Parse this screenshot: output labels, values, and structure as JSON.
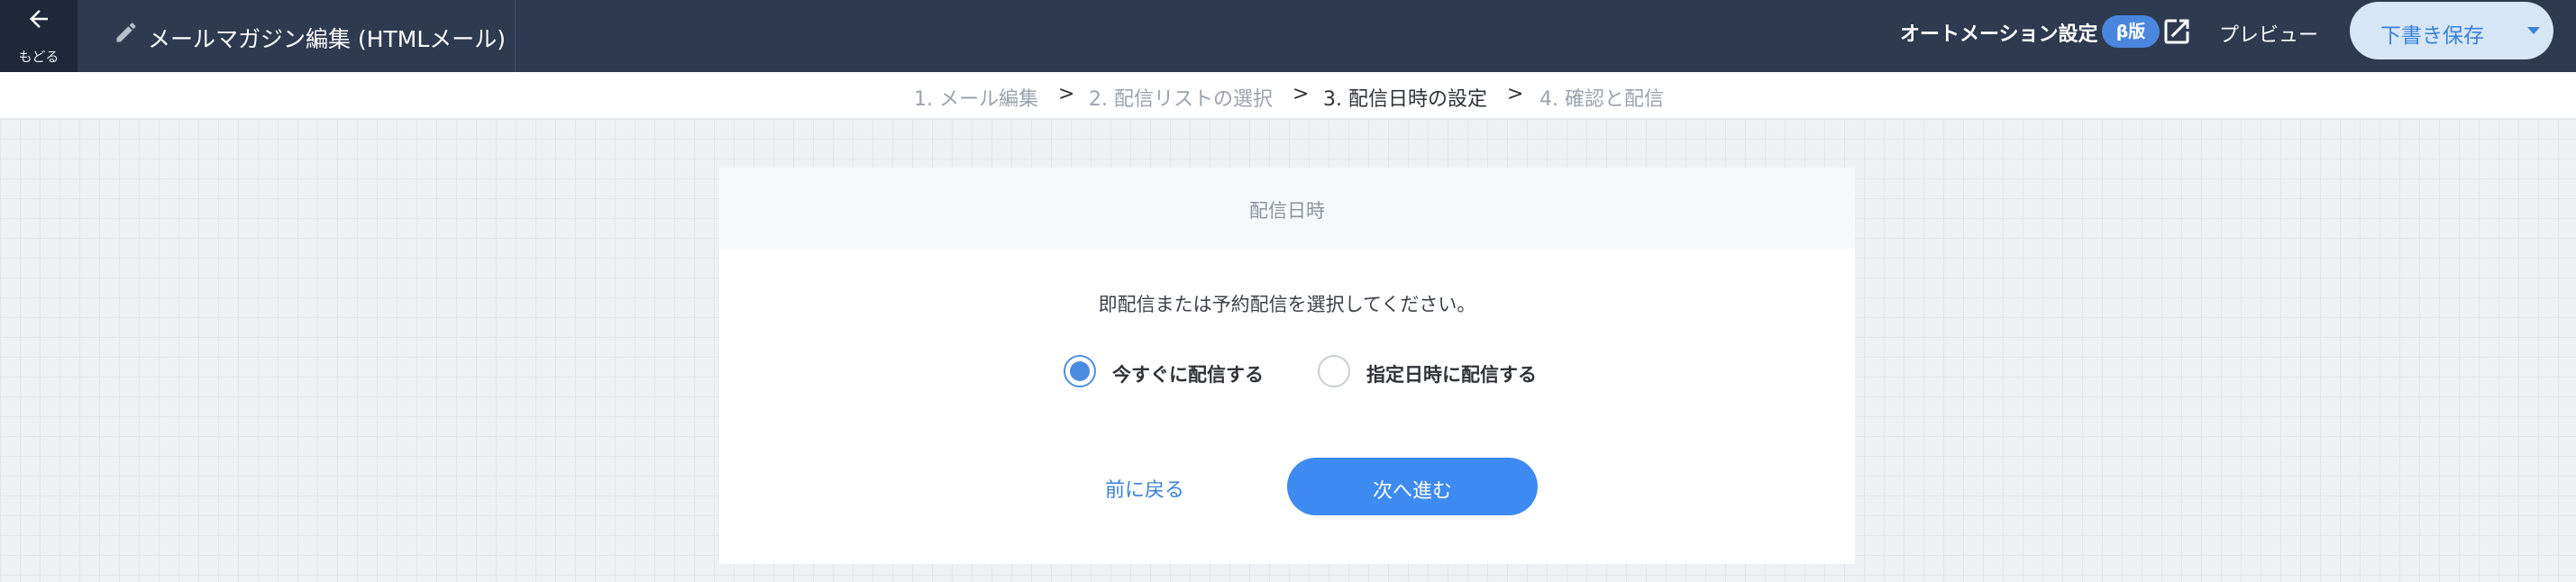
{
  "header": {
    "back_label": "もどる",
    "title": "メールマガジン編集 (HTMLメール)",
    "automation_label": "オートメーション設定",
    "beta_badge": "β版",
    "preview_label": "プレビュー",
    "save_label": "下書き保存"
  },
  "stepper": {
    "steps": [
      {
        "label": "1. メール編集",
        "state": "done"
      },
      {
        "label": "2. 配信リストの選択",
        "state": "done"
      },
      {
        "label": "3. 配信日時の設定",
        "state": "active"
      },
      {
        "label": "4. 確認と配信",
        "state": "pending"
      }
    ],
    "separator": ">"
  },
  "card": {
    "header_label": "配信日時",
    "instruction": "即配信または予約配信を選択してください。",
    "options": [
      {
        "label": "今すぐに配信する",
        "checked": true
      },
      {
        "label": "指定日時に配信する",
        "checked": false
      }
    ],
    "back_label": "前に戻る",
    "next_label": "次へ進む"
  },
  "colors": {
    "header_bg": "#2d3a4f",
    "accent": "#3d8af0",
    "link": "#3a82d9",
    "save_button_bg": "#d7e6f6"
  },
  "icons": {
    "back": "arrow-left-icon",
    "edit": "pencil-icon",
    "external": "external-link-icon",
    "caret": "caret-down-icon"
  }
}
